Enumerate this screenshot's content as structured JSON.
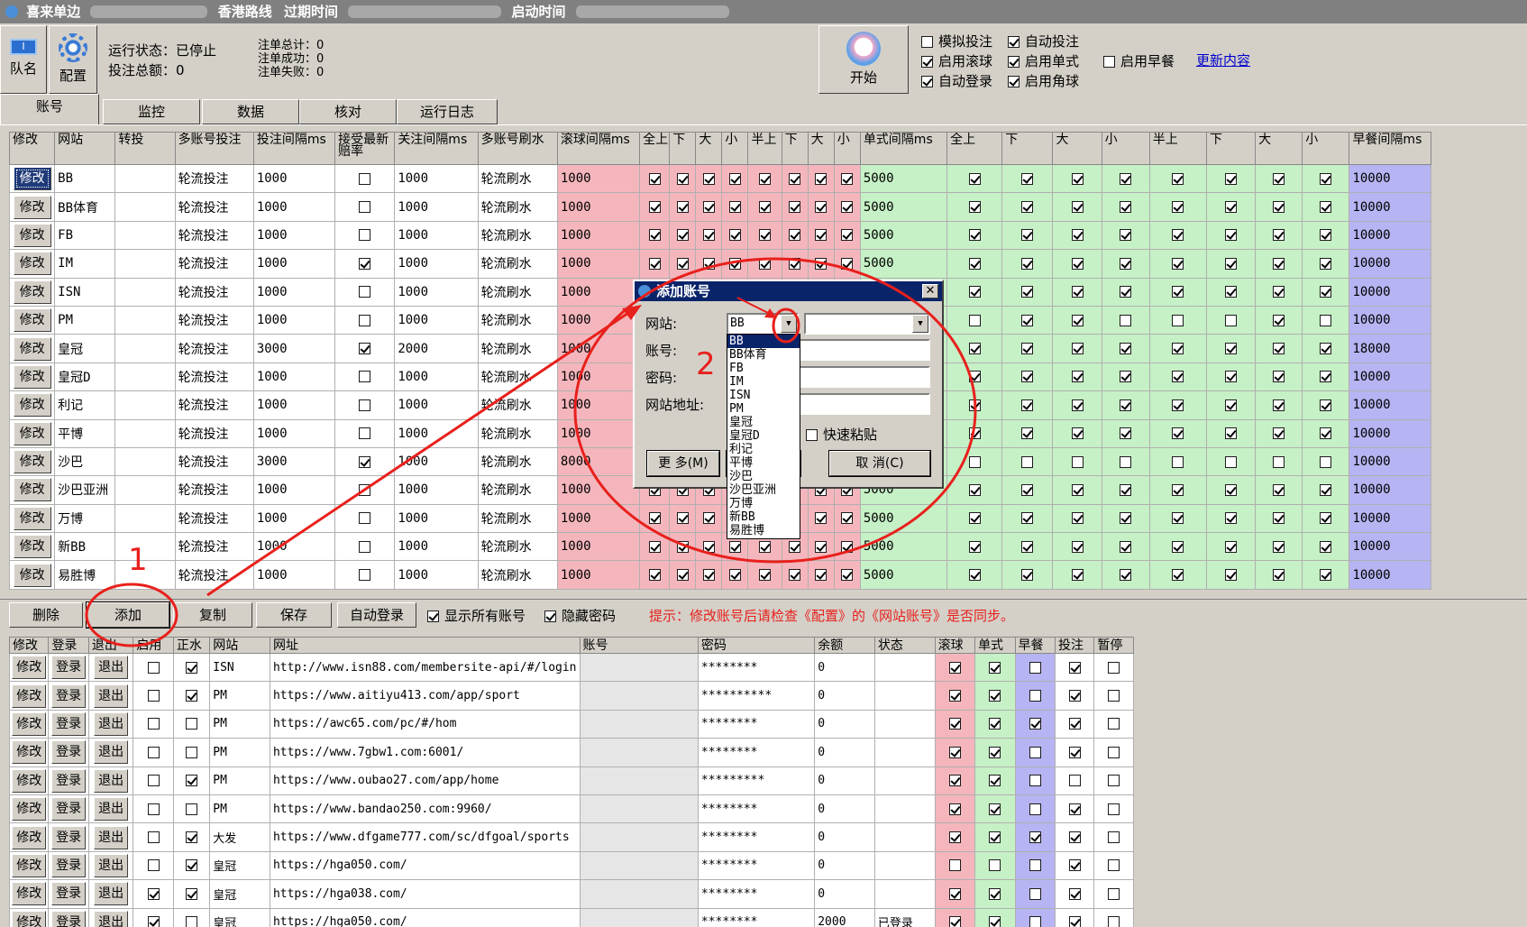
{
  "window": {
    "title": "喜来单边",
    "route": "香港路线",
    "expire_label": "过期时间",
    "start_label": "启动时间"
  },
  "toolbar_top": {
    "team_label": "队名",
    "config_label": "配置",
    "start_label": "开始"
  },
  "status": {
    "run_state": "运行状态：已停止",
    "total_amount": "投注总额：0",
    "order_total": "注单总计：0",
    "order_success": "注单成功：0",
    "order_fail": "注单失败：0"
  },
  "options": [
    {
      "label": "模拟投注",
      "checked": false
    },
    {
      "label": "自动投注",
      "checked": true
    },
    {
      "label": "启用滚球",
      "checked": true
    },
    {
      "label": "启用单式",
      "checked": true
    },
    {
      "label": "启用早餐",
      "checked": false
    },
    {
      "label": "自动登录",
      "checked": true
    },
    {
      "label": "启用角球",
      "checked": true
    }
  ],
  "update_link": "更新内容",
  "tabs": [
    "账号",
    "监控",
    "数据",
    "核对",
    "运行日志"
  ],
  "grid1": {
    "headers": [
      "修改",
      "网站",
      "转投",
      "多账号投注",
      "投注间隔ms",
      "接受最新赔率",
      "关注间隔ms",
      "多账号刷水",
      "滚球间隔ms",
      "全上",
      "下",
      "大",
      "小",
      "半上",
      "下",
      "大",
      "小",
      "单式间隔ms",
      "全上",
      "下",
      "大",
      "小",
      "半上",
      "下",
      "大",
      "小",
      "早餐间隔ms"
    ],
    "edit_label": "修改",
    "rows": [
      {
        "site": "BB",
        "mode": "轮流投注",
        "bet_interval": "1000",
        "accept": false,
        "watch": "1000",
        "refresh": "轮流刷水",
        "live": "1000",
        "live_checks": [
          true,
          true,
          true,
          true,
          true,
          true,
          true,
          true
        ],
        "single": "5000",
        "single_checks": [
          true,
          true,
          true,
          true,
          true,
          true,
          true,
          true
        ],
        "early": "10000"
      },
      {
        "site": "BB体育",
        "mode": "轮流投注",
        "bet_interval": "1000",
        "accept": false,
        "watch": "1000",
        "refresh": "轮流刷水",
        "live": "1000",
        "live_checks": [
          true,
          true,
          true,
          true,
          true,
          true,
          true,
          true
        ],
        "single": "5000",
        "single_checks": [
          true,
          true,
          true,
          true,
          true,
          true,
          true,
          true
        ],
        "early": "10000"
      },
      {
        "site": "FB",
        "mode": "轮流投注",
        "bet_interval": "1000",
        "accept": false,
        "watch": "1000",
        "refresh": "轮流刷水",
        "live": "1000",
        "live_checks": [
          true,
          true,
          true,
          true,
          true,
          true,
          true,
          true
        ],
        "single": "5000",
        "single_checks": [
          true,
          true,
          true,
          true,
          true,
          true,
          true,
          true
        ],
        "early": "10000"
      },
      {
        "site": "IM",
        "mode": "轮流投注",
        "bet_interval": "1000",
        "accept": true,
        "watch": "1000",
        "refresh": "轮流刷水",
        "live": "1000",
        "live_checks": [
          true,
          true,
          true,
          true,
          true,
          true,
          true,
          true
        ],
        "single": "5000",
        "single_checks": [
          true,
          true,
          true,
          true,
          true,
          true,
          true,
          true
        ],
        "early": "10000"
      },
      {
        "site": "ISN",
        "mode": "轮流投注",
        "bet_interval": "1000",
        "accept": false,
        "watch": "1000",
        "refresh": "轮流刷水",
        "live": "1000",
        "live_checks": [
          true,
          true,
          true,
          true,
          true,
          true,
          true,
          true
        ],
        "single": "5000",
        "single_checks": [
          true,
          true,
          true,
          true,
          true,
          true,
          true,
          true
        ],
        "early": "10000"
      },
      {
        "site": "PM",
        "mode": "轮流投注",
        "bet_interval": "1000",
        "accept": false,
        "watch": "1000",
        "refresh": "轮流刷水",
        "live": "1000",
        "live_checks": [
          true,
          true,
          true,
          true,
          true,
          true,
          true,
          true
        ],
        "single": "5000",
        "single_checks": [
          false,
          true,
          true,
          false,
          false,
          false,
          true,
          false
        ],
        "early": "10000"
      },
      {
        "site": "皇冠",
        "mode": "轮流投注",
        "bet_interval": "3000",
        "accept": true,
        "watch": "2000",
        "refresh": "轮流刷水",
        "live": "1000",
        "live_checks": [
          true,
          true,
          true,
          true,
          true,
          true,
          true,
          true
        ],
        "single": "5000",
        "single_checks": [
          true,
          true,
          true,
          true,
          true,
          true,
          true,
          true
        ],
        "early": "18000"
      },
      {
        "site": "皇冠D",
        "mode": "轮流投注",
        "bet_interval": "1000",
        "accept": false,
        "watch": "1000",
        "refresh": "轮流刷水",
        "live": "1000",
        "live_checks": [
          true,
          true,
          true,
          true,
          true,
          true,
          true,
          true
        ],
        "single": "5000",
        "single_checks": [
          true,
          true,
          true,
          true,
          true,
          true,
          true,
          true
        ],
        "early": "10000"
      },
      {
        "site": "利记",
        "mode": "轮流投注",
        "bet_interval": "1000",
        "accept": false,
        "watch": "1000",
        "refresh": "轮流刷水",
        "live": "1000",
        "live_checks": [
          true,
          true,
          true,
          true,
          true,
          true,
          true,
          true
        ],
        "single": "5000",
        "single_checks": [
          true,
          true,
          true,
          true,
          true,
          true,
          true,
          true
        ],
        "early": "10000"
      },
      {
        "site": "平博",
        "mode": "轮流投注",
        "bet_interval": "1000",
        "accept": false,
        "watch": "1000",
        "refresh": "轮流刷水",
        "live": "1000",
        "live_checks": [
          true,
          true,
          true,
          true,
          true,
          true,
          true,
          true
        ],
        "single": "5000",
        "single_checks": [
          true,
          true,
          true,
          true,
          true,
          true,
          true,
          true
        ],
        "early": "10000"
      },
      {
        "site": "沙巴",
        "mode": "轮流投注",
        "bet_interval": "3000",
        "accept": true,
        "watch": "1000",
        "refresh": "轮流刷水",
        "live": "8000",
        "live_checks": [
          true,
          true,
          true,
          true,
          true,
          true,
          true,
          true
        ],
        "single": "5000",
        "single_checks": [
          false,
          false,
          false,
          false,
          false,
          false,
          false,
          false
        ],
        "early": "10000"
      },
      {
        "site": "沙巴亚洲",
        "mode": "轮流投注",
        "bet_interval": "1000",
        "accept": false,
        "watch": "1000",
        "refresh": "轮流刷水",
        "live": "1000",
        "live_checks": [
          true,
          true,
          true,
          true,
          true,
          true,
          true,
          true
        ],
        "single": "5000",
        "single_checks": [
          true,
          true,
          true,
          true,
          true,
          true,
          true,
          true
        ],
        "early": "10000"
      },
      {
        "site": "万博",
        "mode": "轮流投注",
        "bet_interval": "1000",
        "accept": false,
        "watch": "1000",
        "refresh": "轮流刷水",
        "live": "1000",
        "live_checks": [
          true,
          true,
          true,
          true,
          true,
          true,
          true,
          true
        ],
        "single": "5000",
        "single_checks": [
          true,
          true,
          true,
          true,
          true,
          true,
          true,
          true
        ],
        "early": "10000"
      },
      {
        "site": "新BB",
        "mode": "轮流投注",
        "bet_interval": "1000",
        "accept": false,
        "watch": "1000",
        "refresh": "轮流刷水",
        "live": "1000",
        "live_checks": [
          true,
          true,
          true,
          true,
          true,
          true,
          true,
          true
        ],
        "single": "5000",
        "single_checks": [
          true,
          true,
          true,
          true,
          true,
          true,
          true,
          true
        ],
        "early": "10000"
      },
      {
        "site": "易胜博",
        "mode": "轮流投注",
        "bet_interval": "1000",
        "accept": false,
        "watch": "1000",
        "refresh": "轮流刷水",
        "live": "1000",
        "live_checks": [
          true,
          true,
          true,
          true,
          true,
          true,
          true,
          true
        ],
        "single": "5000",
        "single_checks": [
          true,
          true,
          true,
          true,
          true,
          true,
          true,
          true
        ],
        "early": "10000"
      }
    ]
  },
  "actions": {
    "delete": "删除",
    "add": "添加",
    "copy": "复制",
    "save": "保存",
    "auto_login": "自动登录",
    "show_all": "显示所有账号",
    "hide_password": "隐藏密码",
    "hint": "提示：修改账号后请检查《配置》的《网站账号》是否同步。"
  },
  "grid2": {
    "headers": [
      "修改",
      "登录",
      "退出",
      "启用",
      "正水",
      "网站",
      "网址",
      "账号",
      "密码",
      "余额",
      "状态",
      "滚球",
      "单式",
      "早餐",
      "投注",
      "暂停"
    ],
    "edit_label": "修改",
    "login_label": "登录",
    "logout_label": "退出",
    "rows": [
      {
        "enabled": false,
        "positive": true,
        "site": "ISN",
        "url": "http://www.isn88.com/membersite-api/#/login",
        "password": "********",
        "balance": "0",
        "state": "",
        "flags": [
          true,
          true,
          false,
          true,
          false
        ]
      },
      {
        "enabled": false,
        "positive": true,
        "site": "PM",
        "url": "https://www.aitiyu413.com/app/sport",
        "password": "**********",
        "balance": "0",
        "state": "",
        "flags": [
          true,
          true,
          false,
          true,
          false
        ]
      },
      {
        "enabled": false,
        "positive": false,
        "site": "PM",
        "url": "https://awc65.com/pc/#/hom",
        "password": "********",
        "balance": "0",
        "state": "",
        "flags": [
          true,
          true,
          true,
          true,
          false
        ]
      },
      {
        "enabled": false,
        "positive": false,
        "site": "PM",
        "url": "https://www.7gbw1.com:6001/",
        "password": "********",
        "balance": "0",
        "state": "",
        "flags": [
          true,
          true,
          false,
          true,
          false
        ]
      },
      {
        "enabled": false,
        "positive": true,
        "site": "PM",
        "url": "https://www.oubao27.com/app/home",
        "password": "*********",
        "balance": "0",
        "state": "",
        "flags": [
          true,
          true,
          false,
          false,
          false
        ]
      },
      {
        "enabled": false,
        "positive": false,
        "site": "PM",
        "url": "https://www.bandao250.com:9960/",
        "password": "********",
        "balance": "0",
        "state": "",
        "flags": [
          true,
          true,
          false,
          true,
          false
        ]
      },
      {
        "enabled": false,
        "positive": true,
        "site": "大发",
        "url": "https://www.dfgame777.com/sc/dfgoal/sports",
        "password": "********",
        "balance": "0",
        "state": "",
        "flags": [
          true,
          true,
          true,
          true,
          false
        ]
      },
      {
        "enabled": false,
        "positive": true,
        "site": "皇冠",
        "url": "https://hga050.com/",
        "password": "********",
        "balance": "0",
        "state": "",
        "flags": [
          false,
          false,
          false,
          true,
          false
        ]
      },
      {
        "enabled": true,
        "positive": true,
        "site": "皇冠",
        "url": "https://hga038.com/",
        "password": "********",
        "balance": "0",
        "state": "",
        "flags": [
          true,
          true,
          false,
          true,
          false
        ]
      },
      {
        "enabled": true,
        "positive": false,
        "site": "皇冠",
        "url": "https://hga050.com/",
        "password": "********",
        "balance": "2000",
        "state": "已登录",
        "flags": [
          true,
          true,
          false,
          true,
          false
        ]
      }
    ]
  },
  "dialog": {
    "title": "添加账号",
    "site_label": "网站:",
    "account_label": "账号:",
    "password_label": "密码:",
    "url_label": "网站地址:",
    "site_value": "BB",
    "quick_paste": "快速粘贴",
    "more_button": "更 多(M)",
    "ok_fragment": "D",
    "cancel_button": "取 消(C)",
    "options": [
      "BB",
      "BB体育",
      "FB",
      "IM",
      "ISN",
      "PM",
      "皇冠",
      "皇冠D",
      "利记",
      "平博",
      "沙巴",
      "沙巴亚洲",
      "万博",
      "新BB",
      "易胜博"
    ]
  },
  "annotations": {
    "step1": "1",
    "step2": "2",
    "color": "#e8201c"
  }
}
